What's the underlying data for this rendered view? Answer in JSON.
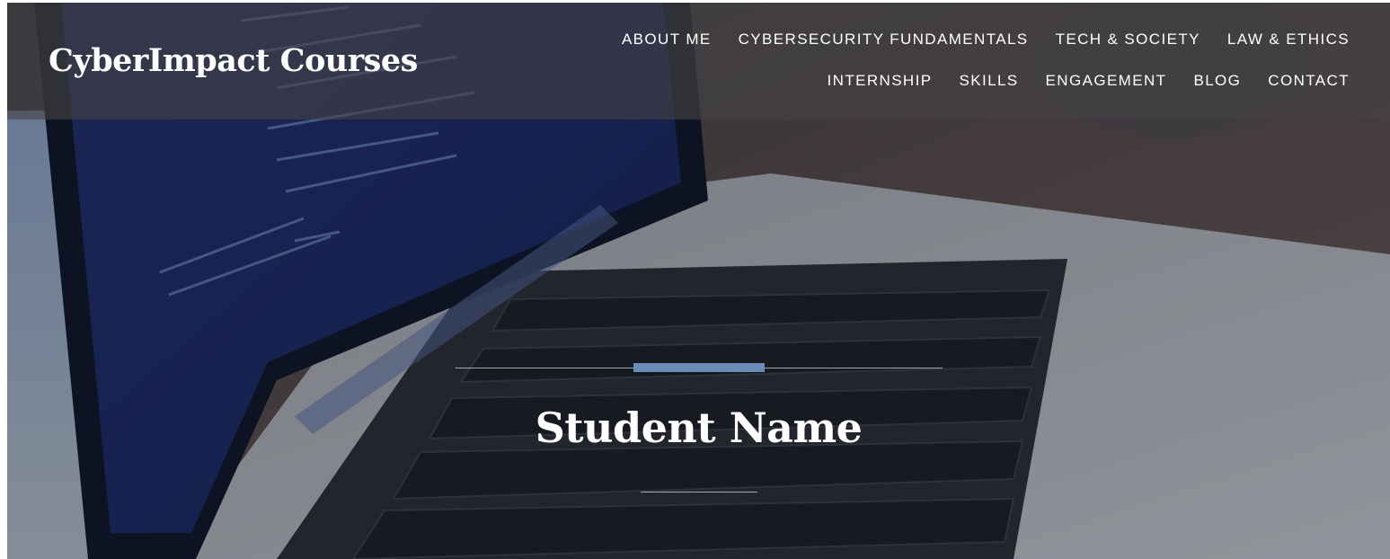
{
  "header": {
    "site_title": "CyberImpact Courses"
  },
  "nav": {
    "row1": [
      {
        "label": "ABOUT ME"
      },
      {
        "label": "CYBERSECURITY FUNDAMENTALS"
      },
      {
        "label": "TECH & SOCIETY"
      },
      {
        "label": "LAW & ETHICS"
      }
    ],
    "row2": [
      {
        "label": "INTERNSHIP"
      },
      {
        "label": "SKILLS"
      },
      {
        "label": "ENGAGEMENT"
      },
      {
        "label": "BLOG"
      },
      {
        "label": "CONTACT"
      }
    ]
  },
  "hero": {
    "title": "Student Name",
    "accent_color": "#6b8cb9",
    "background_image": "laptop-code-photo"
  }
}
